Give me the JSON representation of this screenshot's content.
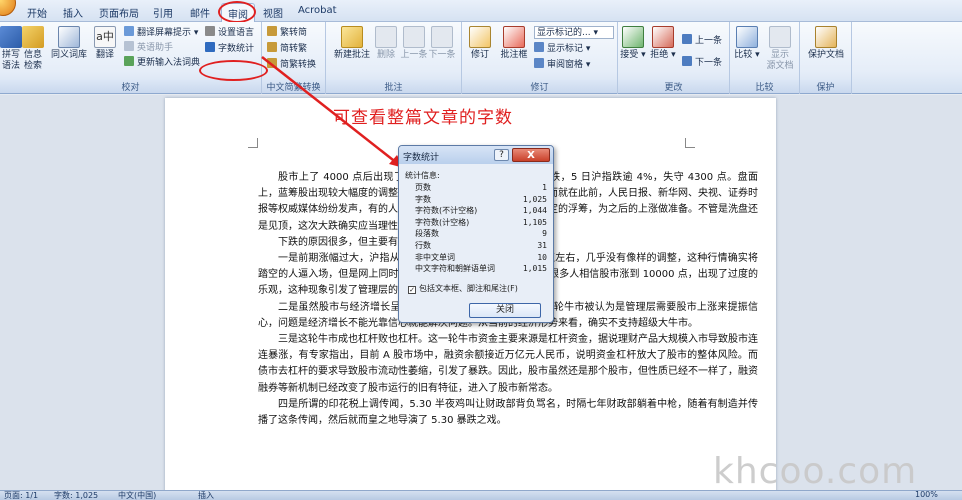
{
  "tabs": [
    "开始",
    "插入",
    "页面布局",
    "引用",
    "邮件",
    "审阅",
    "视图",
    "Acrobat"
  ],
  "active_tab": "审阅",
  "ribbon": {
    "proofing": {
      "label": "校对",
      "spelling": [
        "拼写",
        "语法"
      ],
      "research": [
        "信息",
        "检索"
      ],
      "thesaurus": "同义词库",
      "translate": "翻译",
      "translate_tip": "翻译屏幕提示",
      "language": "英语助手",
      "update_ime": "更新输入法词典",
      "set_language": "设置语言",
      "word_count": "字数统计"
    },
    "chinese_conversion": {
      "label": "中文简繁转换",
      "to_traditional": "繁转简",
      "to_simplified": "简转繁",
      "conversion": "简繁转换"
    },
    "comments": {
      "label": "批注",
      "new": "新建批注",
      "delete": "删除",
      "previous": "上一条",
      "next": "下一条"
    },
    "tracking": {
      "label": "修订",
      "track": "修订",
      "balloons": "批注框",
      "display": "显示标记的...",
      "show_markup": "显示标记",
      "review_pane": "审阅窗格"
    },
    "changes": {
      "label": "更改",
      "accept": "接受",
      "reject": "拒绝",
      "previous": "上一条",
      "next": "下一条"
    },
    "compare": {
      "label": "比较",
      "compare": "比较",
      "show_source": [
        "显示",
        "源文档"
      ]
    },
    "protect": {
      "label": "保护",
      "protect_doc": "保护文档"
    }
  },
  "annotation": "可查看整篇文章的字数",
  "document_paragraphs": [
    "股市上了 4000 点后出现了大幅度的调整，一些个股出现暴跌，5 日沪指跌逾 4%，失守 4300 点。盘面上，蓝筹股出现较大幅度的调整，众多个股跌停。在大跌隔居前，而就在此前，人民日报、新华网、央视、证券时报等权威媒体纷纷发声，有的人认为是洗盘，为了更好地洗去不坚定的浮筹，为之后的上涨做准备。不管是洗盘还是见顶，这次大跌确实应当理性分析一下原因了。",
    "下跌的原因很多，但主要有以下几个方面：",
    "一是前期涨幅过大，沪指从 2000 多点一路上涨到了 4500 点左右，几乎没有像样的调整，这种行情确实将踏空的人逼入场，但是网上同时传染，人们已经渐渐失去了警惕，很多人相信股市涨到 10000 点，出现了过度的乐观，这种现象引发了管理层的关注，借助官媒的发声。",
    "二是虽然股市与经济增长呈正常背离，但也不能太离谱。这一轮牛市被认为是管理层需要股市上涨来提振信心，问题是经济增长不能光靠信心就能解决问题。从当前的经济形势来看，确实不支持超级大牛市。",
    "三是这轮牛市成也杠杆败也杠杆。这一轮牛市资金主要来源是杠杆资金，据说理财产品大规模入市导致股市连连暴涨，有专家指出，目前 A 股市场中，融资余额接近万亿元人民币，说明资金杠杆放大了股市的整体风险。而债市去杠杆的要求导致股市流动性萎缩，引发了暴跌。因此，股市虽然还是那个股市，但性质已经不一样了，融资融券等新机制已经改变了股市运行的旧有特征，进入了股市新常态。",
    "四是所谓的印花税上调传闻，5.30 半夜鸡叫让财政部背负骂名，时隔七年财政部躺着中枪，随着有制造并传播了这条传闻，然后就而皇之地导演了 5.30 暴跌之戏。"
  ],
  "dialog": {
    "title": "字数统计",
    "help": "?",
    "close_x": "X",
    "section_label": "统计信息:",
    "stats": [
      {
        "label": "页数",
        "value": "1"
      },
      {
        "label": "字数",
        "value": "1,025"
      },
      {
        "label": "字符数(不计空格)",
        "value": "1,044"
      },
      {
        "label": "字符数(计空格)",
        "value": "1,105"
      },
      {
        "label": "段落数",
        "value": "9"
      },
      {
        "label": "行数",
        "value": "31"
      },
      {
        "label": "非中文单词",
        "value": "10"
      },
      {
        "label": "中文字符和朝鲜语单词",
        "value": "1,015"
      }
    ],
    "checkbox_label": "包括文本框、脚注和尾注(F)",
    "checkbox_checked": true,
    "close_button": "关闭"
  },
  "statusbar": {
    "page": "页面: 1/1",
    "words": "字数: 1,025",
    "language": "中文(中国)",
    "mode": "插入",
    "zoom": "100%"
  },
  "watermark": "khcoo.com",
  "colors": {
    "annotation_red": "#e02020",
    "ribbon_blue": "#d6e2f2"
  }
}
